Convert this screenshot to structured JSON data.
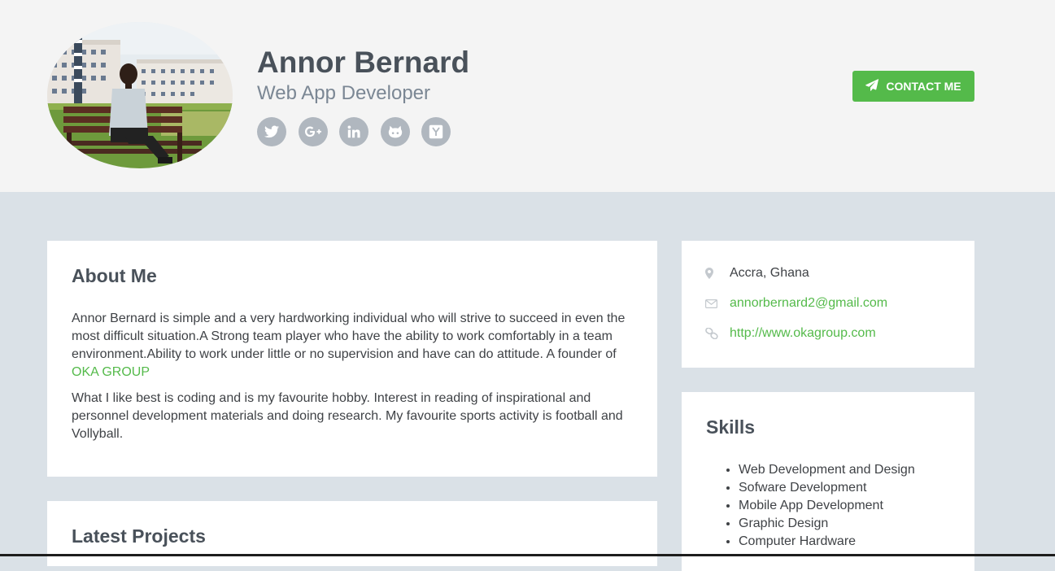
{
  "profile": {
    "name": "Annor Bernard",
    "title": "Web App Developer"
  },
  "social": [
    {
      "icon": "twitter-icon"
    },
    {
      "icon": "google-plus-icon"
    },
    {
      "icon": "linkedin-icon"
    },
    {
      "icon": "github-icon"
    },
    {
      "icon": "hacker-news-icon"
    }
  ],
  "contact_button": {
    "label": "CONTACT ME",
    "icon": "paper-plane-icon"
  },
  "about": {
    "title": "About Me",
    "para1": "Annor Bernard is simple and a very hardworking individual who will strive to succeed in even the most difficult situation.A Strong team player who have the ability to work comfortably in a team environment.Ability to work under little or no supervision and have can do attitude. A founder of ",
    "para1_link": "OKA GROUP",
    "para2": "What I like best is coding and is my favourite hobby. Interest in reading of inspirational and personnel development materials and doing research. My favourite sports activity is football and Vollyball."
  },
  "projects": {
    "title": "Latest Projects"
  },
  "info": {
    "location": "Accra, Ghana",
    "email": "annorbernard2@gmail.com",
    "website": "http://www.okagroup.com"
  },
  "skills": {
    "title": "Skills",
    "items": [
      "Web Development and Design",
      "Sofware Development",
      "Mobile App Development",
      "Graphic Design",
      "Computer Hardware"
    ]
  },
  "colors": {
    "accent": "#54ba4a",
    "header_bg": "#f4f4f4",
    "page_bg": "#dae1e7",
    "heading": "#49515a",
    "icon_gray": "#b0b7bf"
  }
}
